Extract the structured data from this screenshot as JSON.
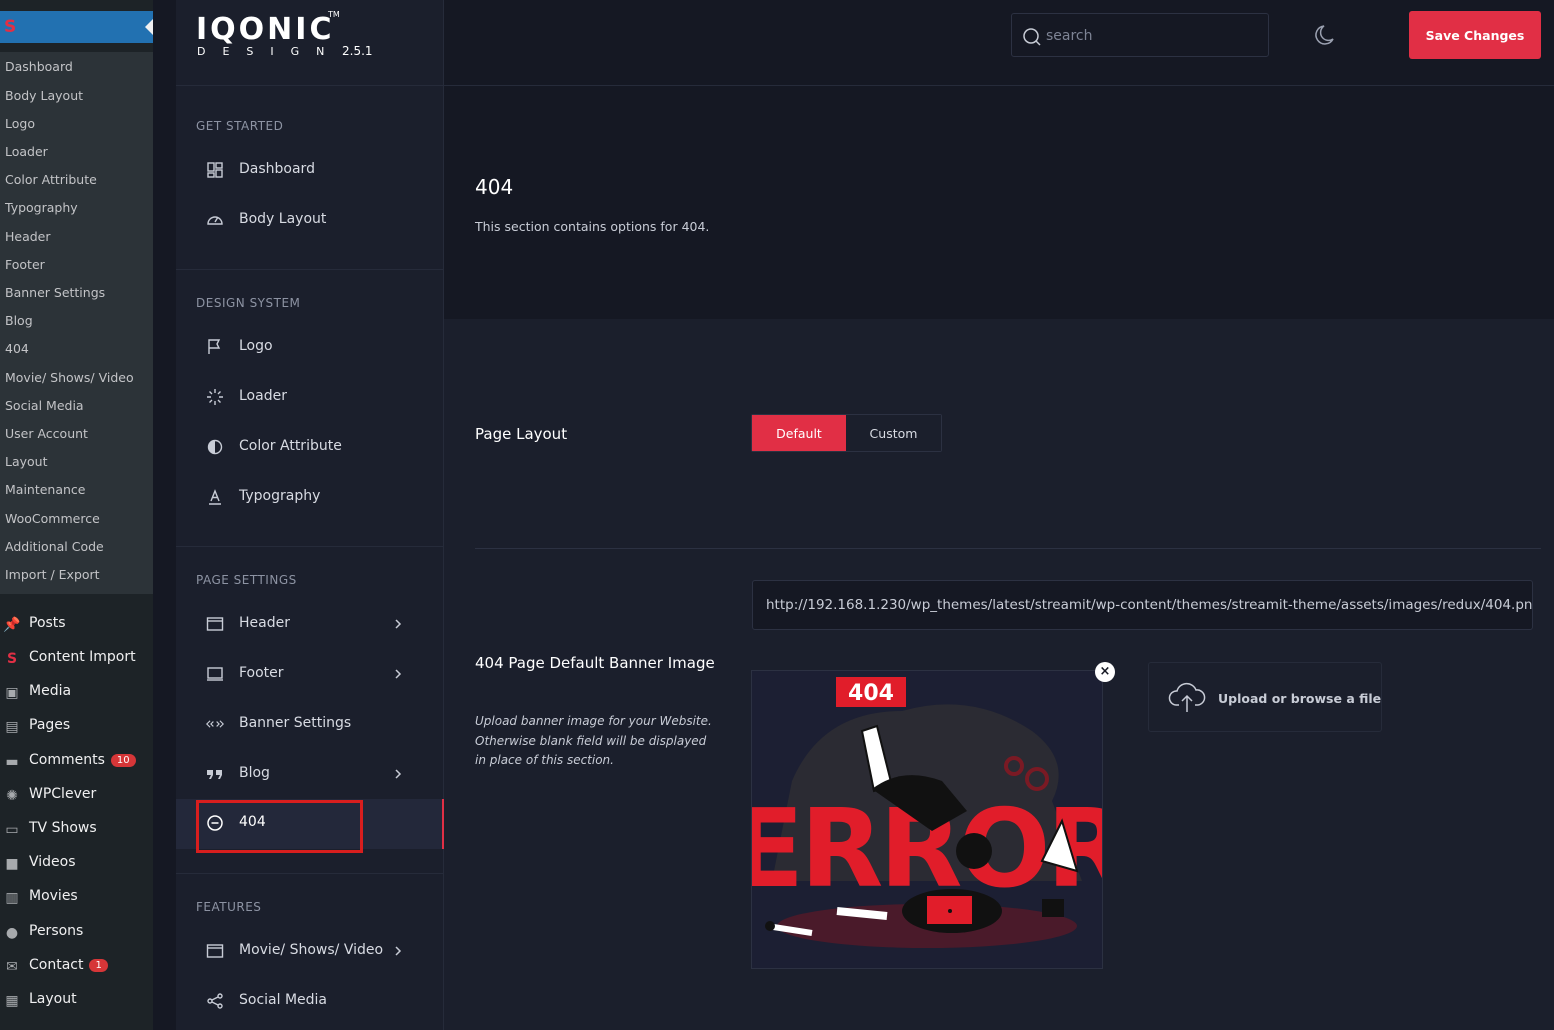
{
  "wp_sidebar": {
    "submenu": [
      "Dashboard",
      "Body Layout",
      "Logo",
      "Loader",
      "Color Attribute",
      "Typography",
      "Header",
      "Footer",
      "Banner Settings",
      "Blog",
      "404",
      "Movie/ Shows/ Video",
      "Social Media",
      "User Account",
      "Layout",
      "Maintenance",
      "WooCommerce",
      "Additional Code",
      "Import / Export"
    ],
    "menu": [
      {
        "label": "Posts",
        "icon": "pin-icon"
      },
      {
        "label": "Content Import",
        "icon": "s-logo-icon"
      },
      {
        "label": "Media",
        "icon": "media-icon"
      },
      {
        "label": "Pages",
        "icon": "pages-icon"
      },
      {
        "label": "Comments",
        "icon": "comment-icon",
        "badge": "10"
      },
      {
        "label": "WPClever",
        "icon": "bulb-icon"
      },
      {
        "label": "TV Shows",
        "icon": "tv-icon"
      },
      {
        "label": "Videos",
        "icon": "video-icon"
      },
      {
        "label": "Movies",
        "icon": "film-icon"
      },
      {
        "label": "Persons",
        "icon": "person-icon"
      },
      {
        "label": "Contact",
        "icon": "mail-icon",
        "badge": "1"
      },
      {
        "label": "Layout",
        "icon": "layout-icon"
      }
    ]
  },
  "brand": {
    "logo": "IQONIC",
    "tm": "TM",
    "sub": "DESIGN",
    "version": "2.5.1"
  },
  "nav": {
    "sections": [
      "GET STARTED",
      "DESIGN SYSTEM",
      "PAGE SETTINGS",
      "FEATURES"
    ],
    "items": [
      {
        "label": "Dashboard",
        "icon": "dashboard-icon"
      },
      {
        "label": "Body Layout",
        "icon": "gauge-icon"
      },
      {
        "label": "Logo",
        "icon": "flag-icon"
      },
      {
        "label": "Loader",
        "icon": "loader-icon"
      },
      {
        "label": "Color Attribute",
        "icon": "contrast-icon"
      },
      {
        "label": "Typography",
        "icon": "typography-icon"
      },
      {
        "label": "Header",
        "icon": "window-icon",
        "has_children": true
      },
      {
        "label": "Footer",
        "icon": "laptop-icon",
        "has_children": true
      },
      {
        "label": "Banner Settings",
        "icon": "code-icon"
      },
      {
        "label": "Blog",
        "icon": "quote-icon",
        "has_children": true
      },
      {
        "label": "404",
        "icon": "minus-circle-icon",
        "active": true
      },
      {
        "label": "Movie/ Shows/ Video",
        "icon": "window-icon",
        "has_children": true
      },
      {
        "label": "Social Media",
        "icon": "share-icon"
      }
    ]
  },
  "topbar": {
    "search_placeholder": "search",
    "save_label": "Save Changes"
  },
  "section": {
    "title": "404",
    "description": "This section contains options for 404."
  },
  "options": {
    "page_layout": {
      "label": "Page Layout",
      "options": [
        "Default",
        "Custom"
      ],
      "selected": "Default"
    },
    "banner": {
      "label": "404 Page Default Banner Image",
      "description": "Upload banner image for your Website. Otherwise blank field will be displayed in place of this section.",
      "url": "http://192.168.1.230/wp_themes/latest/streamit/wp-content/themes/streamit-theme/assets/images/redux/404.png",
      "upload_label": "Upload or browse a file",
      "remove_symbol": "×",
      "image_text_404": "404",
      "image_text_error": "ERROR"
    }
  },
  "colors": {
    "accent": "#e12f45",
    "wp_blue": "#2271b1"
  }
}
